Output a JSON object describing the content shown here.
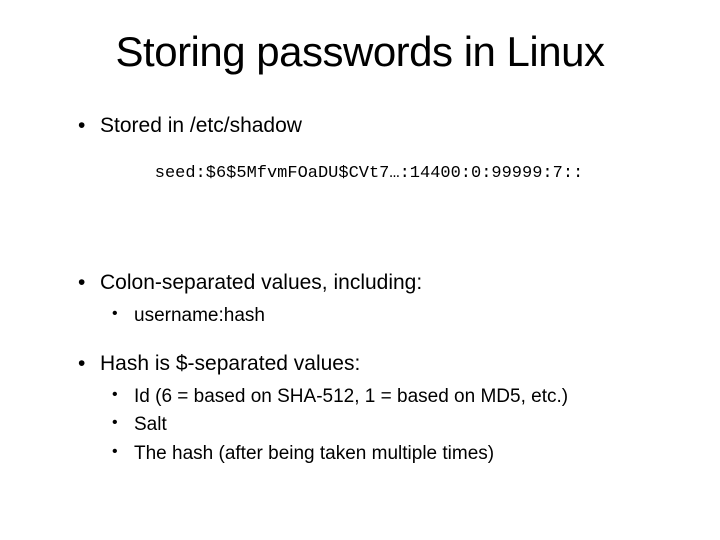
{
  "title": "Storing passwords in Linux",
  "bullets": {
    "stored": "Stored in /etc/shadow",
    "code": "seed:$6$5MfvmFOaDU$CVt7…:14400:0:99999:7::",
    "colon": "Colon-separated values, including:",
    "colon_sub": {
      "userhash": "username:hash"
    },
    "hash": "Hash is $-separated values:",
    "hash_sub": {
      "id": "Id (6 = based on SHA-512, 1 = based on MD5, etc.)",
      "salt": "Salt",
      "thehash": "The hash (after being taken multiple times)"
    }
  }
}
